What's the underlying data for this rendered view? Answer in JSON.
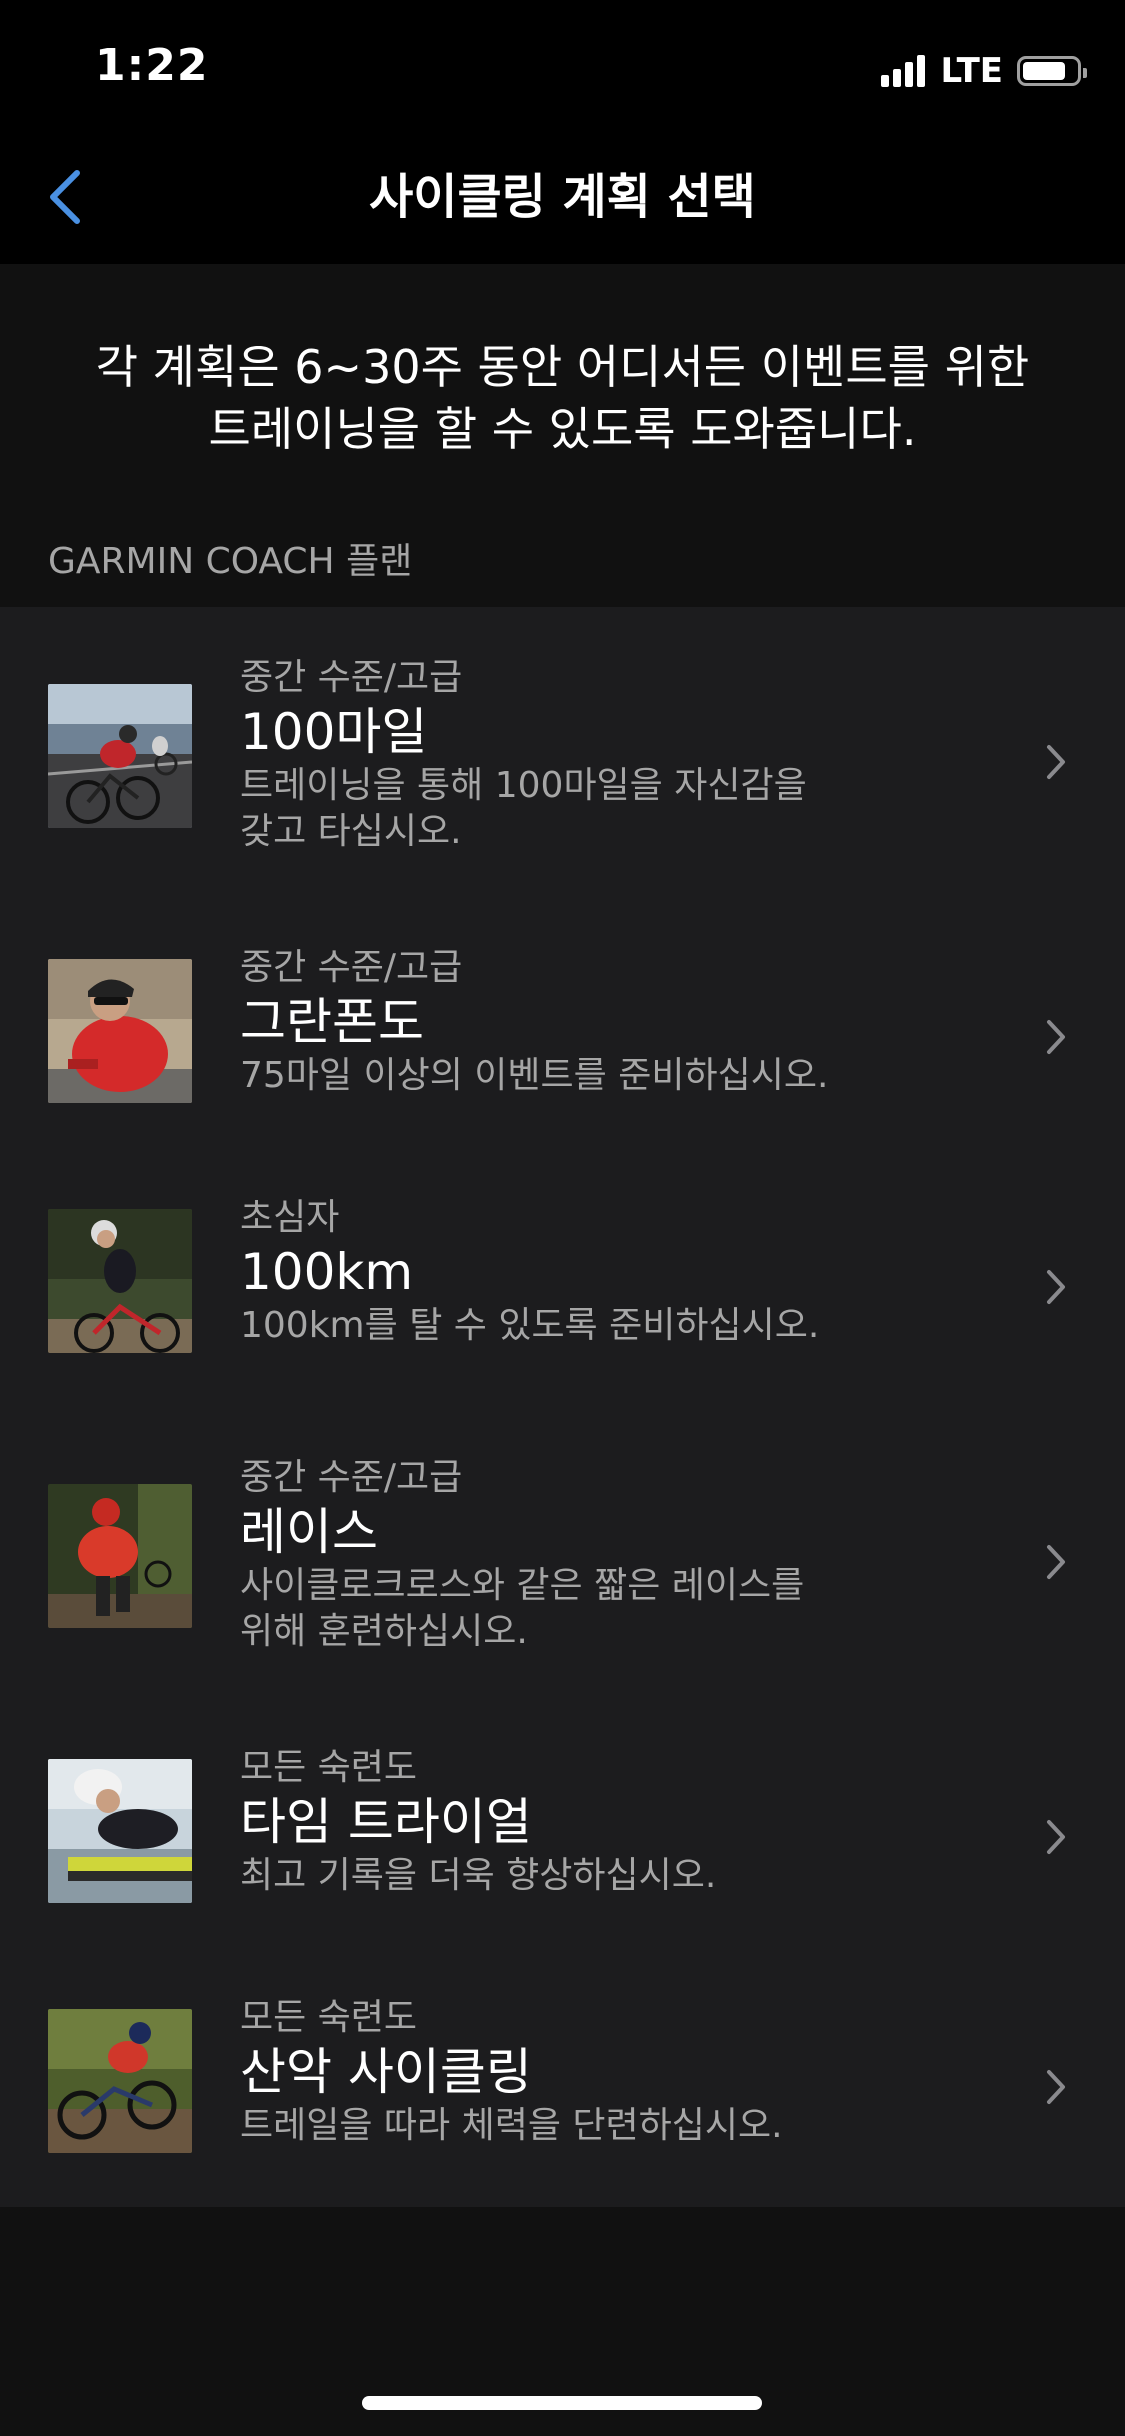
{
  "status_bar": {
    "time": "1:22",
    "network": "LTE",
    "battery_level": 0.8
  },
  "nav": {
    "title": "사이클링 계획 선택",
    "back_icon": "chevron-left-icon",
    "accent_color": "#4a90e2"
  },
  "intro": {
    "line1": "각 계획은 6~30주 동안 어디서든 이벤트를 위한",
    "line2": "트레이닝을 할 수 있도록 도와줍니다."
  },
  "section": {
    "header": "GARMIN COACH 플랜"
  },
  "plans": [
    {
      "level": "중간 수준/고급",
      "title": "100마일",
      "desc_line1": "트레이닝을 통해 100마일을 자신감을",
      "desc_line2": "갖고 타십시오."
    },
    {
      "level": "중간 수준/고급",
      "title": "그란폰도",
      "desc_line1": "75마일 이상의 이벤트를 준비하십시오.",
      "desc_line2": ""
    },
    {
      "level": "초심자",
      "title": "100km",
      "desc_line1": "100km를 탈 수 있도록 준비하십시오.",
      "desc_line2": ""
    },
    {
      "level": "중간 수준/고급",
      "title": "레이스",
      "desc_line1": "사이클로크로스와 같은 짧은 레이스를",
      "desc_line2": "위해 훈련하십시오."
    },
    {
      "level": "모든 숙련도",
      "title": "타임 트라이얼",
      "desc_line1": "최고 기록을 더욱 향상하십시오.",
      "desc_line2": ""
    },
    {
      "level": "모든 숙련도",
      "title": "산악 사이클링",
      "desc_line1": "트레일을 따라 체력을 단련하십시오.",
      "desc_line2": ""
    }
  ]
}
